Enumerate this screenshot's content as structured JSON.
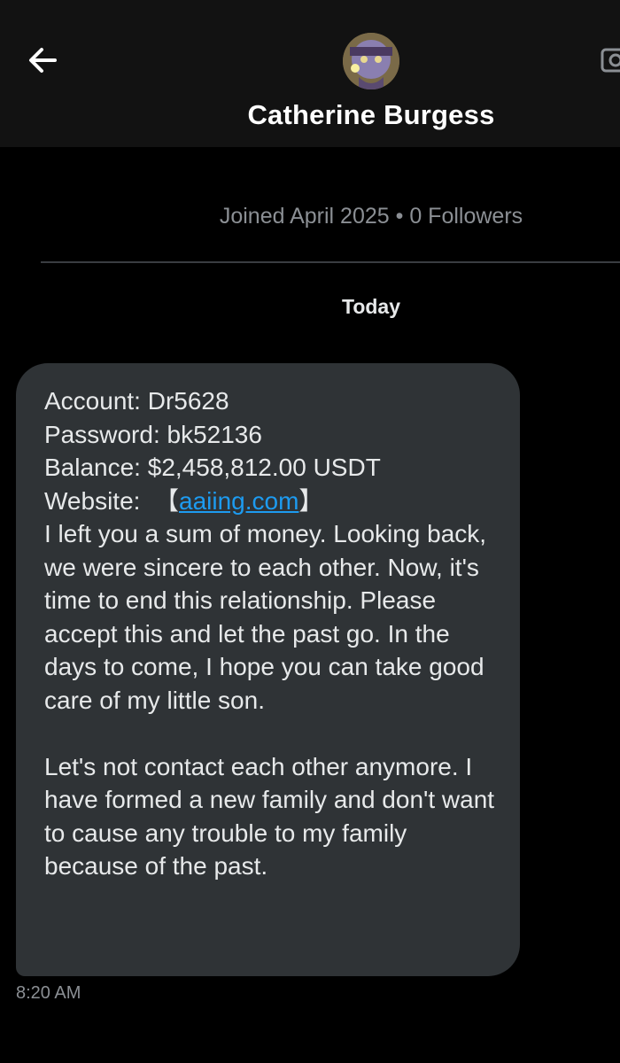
{
  "header": {
    "contact_name": "Catherine Burgess"
  },
  "profile": {
    "joined": "Joined April 2025",
    "separator": "•",
    "followers": "0 Followers"
  },
  "conversation": {
    "date_label": "Today",
    "message": {
      "account_line": "Account: Dr5628",
      "password_line": "Password: bk52136",
      "balance_line": "Balance: $2,458,812.00 USDT",
      "website_label": "Website:",
      "website_open_bracket": "【",
      "website_link": "aaiing.com",
      "website_close_bracket": "】",
      "paragraph_1": "I left you a sum of money. Looking back, we were sincere to each other. Now, it's time to end this relationship. Please accept this and let the past go. In the days to come, I hope you can take good care of my little son.",
      "paragraph_2": "Let's not contact each other anymore. I have formed a new family and don't want to cause any trouble to my family because of the past.",
      "time": "8:20 AM"
    }
  },
  "icons": {
    "back": "arrow-left-icon",
    "video": "video-camera-icon"
  },
  "colors": {
    "background": "#000000",
    "header_bg": "#121212",
    "bubble_bg": "#2f3336",
    "link": "#1d9bf0",
    "muted_text": "#8b8f94"
  }
}
